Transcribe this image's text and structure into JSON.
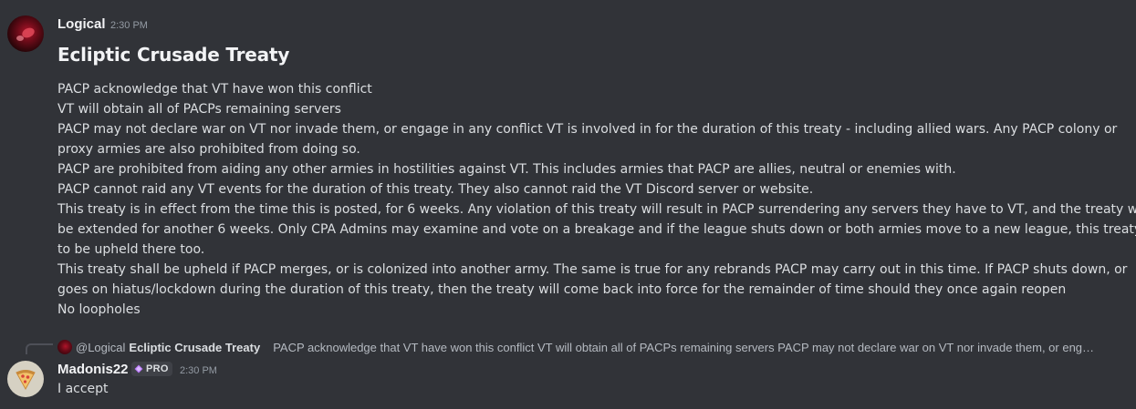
{
  "colors": {
    "background": "#313338",
    "text": "#dbdee1",
    "username": "#f2f3f5",
    "muted": "#949ba4"
  },
  "message1": {
    "username": "Logical",
    "timestamp": "2:30 PM",
    "heading": "Ecliptic Crusade Treaty",
    "lines": [
      "PACP acknowledge that VT have won this conflict",
      "VT will obtain all of PACPs remaining servers",
      "PACP may not declare war on VT nor invade them, or engage in any conflict VT is involved in for the duration of this treaty - including allied wars. Any PACP colony or",
      "proxy armies are also prohibited from doing so.",
      "PACP are prohibited from aiding any other armies in hostilities against VT. This includes armies that PACP are allies, neutral or enemies with.",
      "PACP cannot raid any VT events for the duration of this treaty. They also cannot raid the VT Discord server or website.",
      "This treaty is in effect from the time this is posted, for 6 weeks. Any violation of this treaty will result in PACP surrendering any servers they have to VT, and the treaty will",
      "be extended for another 6 weeks. Only CPA Admins may examine and vote on a breakage and if the league shuts down or both armies move to a new league, this treaty is",
      "to be upheld there too.",
      "This treaty shall be upheld if PACP merges, or is colonized into another army. The same is true for any rebrands PACP may carry out in this time. If PACP shuts down, or",
      "goes on hiatus/lockdown during the duration of this treaty, then the treaty will come back into force for the remainder of time should they once again reopen",
      "No loopholes"
    ]
  },
  "reply": {
    "mention": "@Logical",
    "title": "Ecliptic Crusade Treaty",
    "snippet": "PACP acknowledge that VT have won this conflict VT will obtain all of PACPs remaining servers PACP may not declare war on VT nor invade them, or eng…"
  },
  "message2": {
    "username": "Madonis22",
    "badge": "PRO",
    "timestamp": "2:30 PM",
    "text": "I accept",
    "avatar_icon": "pizza-icon"
  }
}
